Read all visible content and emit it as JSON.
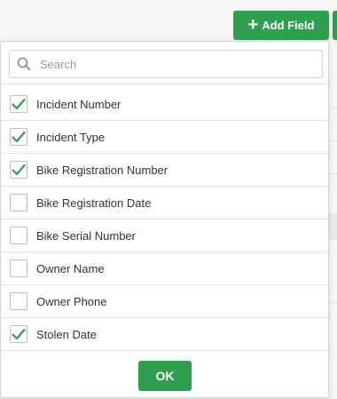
{
  "header": {
    "add_field_label": "Add Field"
  },
  "search": {
    "placeholder": "Search",
    "value": ""
  },
  "fields": [
    {
      "label": "Incident Number",
      "checked": true
    },
    {
      "label": "Incident Type",
      "checked": true
    },
    {
      "label": "Bike Registration Number",
      "checked": true
    },
    {
      "label": "Bike Registration Date",
      "checked": false
    },
    {
      "label": "Bike Serial Number",
      "checked": false
    },
    {
      "label": "Owner Name",
      "checked": false
    },
    {
      "label": "Owner Phone",
      "checked": false
    },
    {
      "label": "Stolen Date",
      "checked": true
    }
  ],
  "footer": {
    "ok_label": "OK"
  },
  "colors": {
    "accent": "#2e9e4f",
    "check": "#2e9e4f"
  },
  "icons": {
    "search": "search-icon",
    "check": "check-icon",
    "plus": "plus-icon"
  }
}
